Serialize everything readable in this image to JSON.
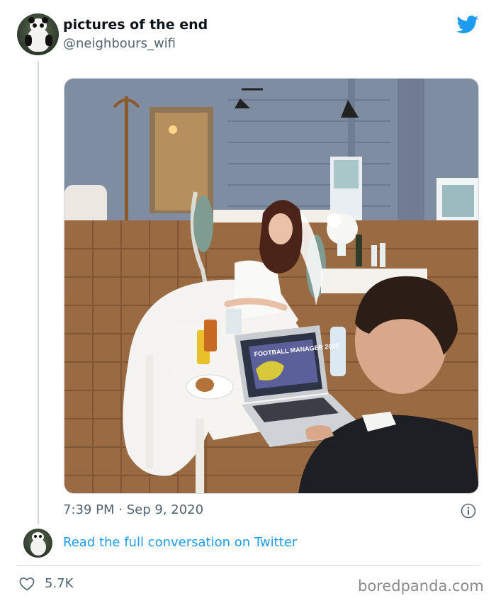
{
  "tweet": {
    "display_name": "pictures of the end",
    "handle": "@neighbours_wifi",
    "timestamp": "7:39 PM · Sep 9, 2020",
    "read_more": "Read the full conversation on Twitter",
    "likes": "5.7K"
  },
  "photo": {
    "laptop_screen_title": "FOOTBALL MANAGER 2020"
  },
  "watermark": "boredpanda.com",
  "colors": {
    "link": "#1d9bf0",
    "twitter_blue": "#1d9bf0",
    "secondary_text": "#536471",
    "divider": "#cfd9de"
  },
  "icons": [
    "twitter-bird-icon",
    "info-icon",
    "heart-icon"
  ]
}
